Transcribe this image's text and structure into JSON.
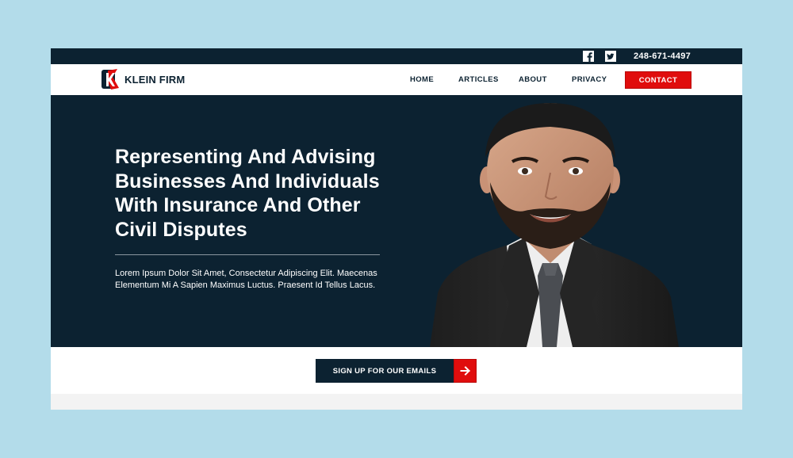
{
  "topbar": {
    "phone": "248-671-4497",
    "social": [
      {
        "icon": "facebook-icon"
      },
      {
        "icon": "twitter-icon"
      }
    ]
  },
  "brand": {
    "name": "KLEIN FIRM",
    "logo_letter": "K"
  },
  "nav": {
    "items": [
      {
        "label": "HOME"
      },
      {
        "label": "ARTICLES"
      },
      {
        "label": "ABOUT"
      },
      {
        "label": "PRIVACY"
      }
    ],
    "contact_label": "CONTACT"
  },
  "hero": {
    "title": "Representing And Advising Businesses And Individuals With Insurance And Other Civil Disputes",
    "text": "Lorem Ipsum Dolor Sit Amet, Consectetur Adipiscing Elit. Maecenas Elementum Mi A Sapien Maximus Luctus. Praesent Id Tellus Lacus."
  },
  "signup": {
    "label": "SIGN UP FOR OUR EMAILS",
    "arrow_icon": "arrow-right-icon"
  },
  "colors": {
    "navy": "#0c2231",
    "accent_red": "#e00d0d",
    "page_bg": "#b3dcea"
  }
}
